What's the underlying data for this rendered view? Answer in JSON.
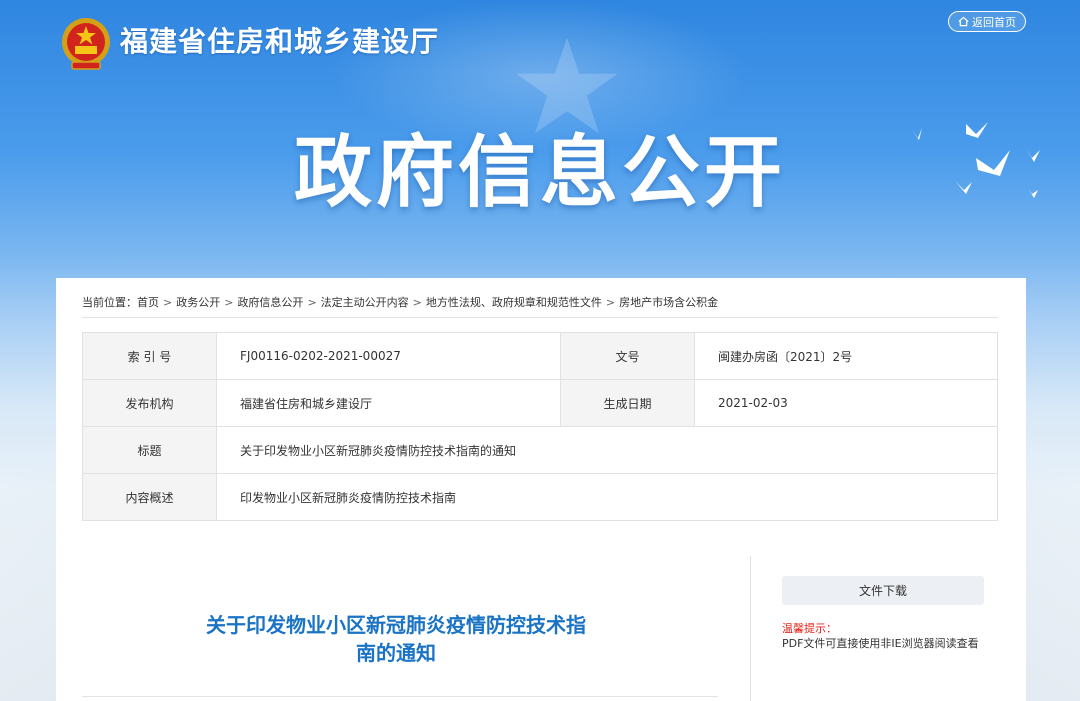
{
  "header": {
    "site_title": "福建省住房和城乡建设厅",
    "home_button": "返回首页"
  },
  "banner": {
    "title": "政府信息公开"
  },
  "breadcrumb": {
    "prefix": "当前位置：",
    "items": [
      "首页",
      "政务公开",
      "政府信息公开",
      "法定主动公开内容",
      "地方性法规、政府规章和规范性文件",
      "房地产市场含公积金"
    ]
  },
  "meta": {
    "index_label": "索 引 号",
    "index_value": "FJ00116-0202-2021-00027",
    "docno_label": "文号",
    "docno_value": "闽建办房函〔2021〕2号",
    "publisher_label": "发布机构",
    "publisher_value": "福建省住房和城乡建设厅",
    "date_label": "生成日期",
    "date_value": "2021-02-03",
    "title_label": "标题",
    "title_value": "关于印发物业小区新冠肺炎疫情防控技术指南的通知",
    "summary_label": "内容概述",
    "summary_value": "印发物业小区新冠肺炎疫情防控技术指南"
  },
  "document": {
    "title_line1": "关于印发物业小区新冠肺炎疫情防控技术指",
    "title_line2": "南的通知"
  },
  "sidebar": {
    "download_button": "文件下载",
    "tip_label": "温馨提示：",
    "tip_text": "PDF文件可直接使用非IE浏览器阅读查看"
  },
  "colors": {
    "accent_blue": "#1a73c4",
    "tip_red": "#e2231a"
  },
  "icons": [
    "national-emblem-icon",
    "home-icon",
    "dove-icon"
  ]
}
